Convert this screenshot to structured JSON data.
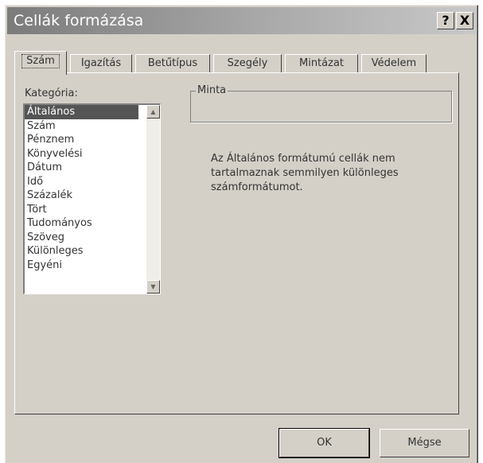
{
  "window": {
    "title": "Cellák formázása",
    "help_glyph": "?",
    "close_glyph": "X"
  },
  "tabs": [
    {
      "label": "Szám",
      "active": true
    },
    {
      "label": "Igazítás"
    },
    {
      "label": "Betűtípus"
    },
    {
      "label": "Szegély"
    },
    {
      "label": "Mintázat"
    },
    {
      "label": "Védelem"
    }
  ],
  "category": {
    "label": "Kategória:",
    "items": [
      "Általános",
      "Szám",
      "Pénznem",
      "Könyvelési",
      "Dátum",
      "Idő",
      "Százalék",
      "Tört",
      "Tudományos",
      "Szöveg",
      "Különleges",
      "Egyéni"
    ],
    "selected": "Általános"
  },
  "sample": {
    "label": "Minta",
    "value": ""
  },
  "description": "Az Általános formátumú cellák nem tartalmaznak semmilyen különleges számformátumot.",
  "buttons": {
    "ok": "OK",
    "cancel": "Mégse"
  }
}
